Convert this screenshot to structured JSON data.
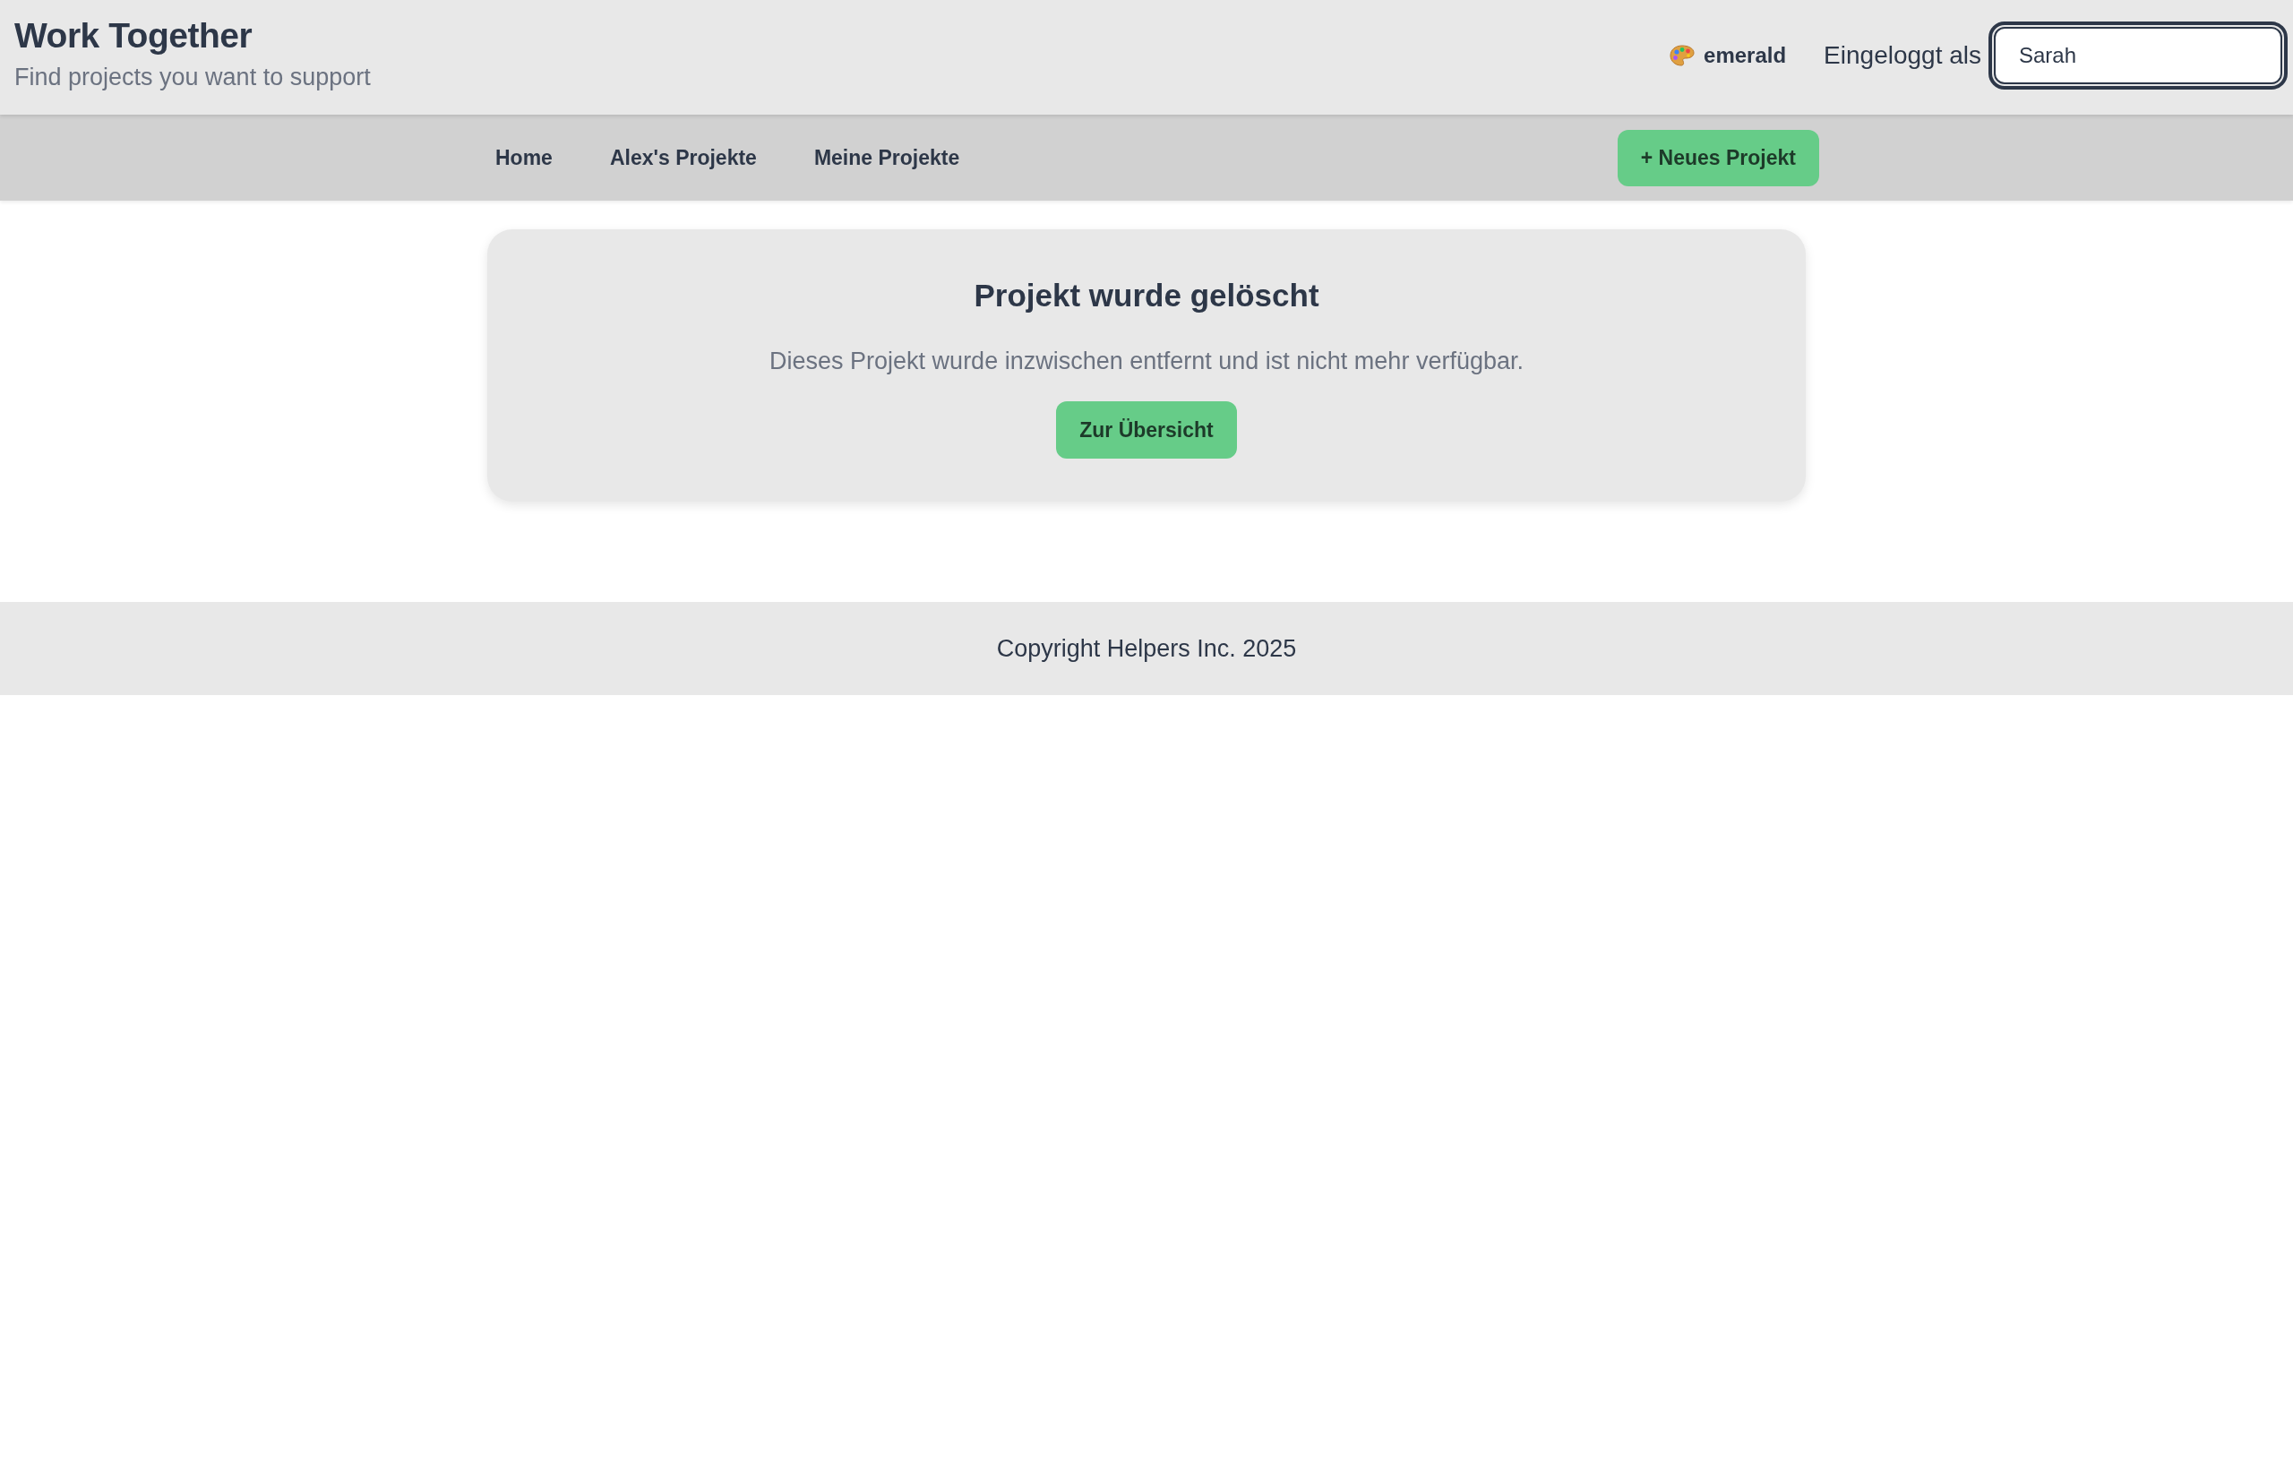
{
  "header": {
    "title": "Work Together",
    "subtitle": "Find projects you want to support",
    "theme": {
      "label": "emerald"
    },
    "login": {
      "label": "Eingeloggt als",
      "user_field": {
        "value": "Sarah",
        "focused": true
      }
    }
  },
  "nav": {
    "links": [
      "Home",
      "Alex's Projekte",
      "Meine Projekte"
    ],
    "new_button": "+ Neues Projekt"
  },
  "notice": {
    "title": "Projekt wurde gelöscht",
    "message": "Dieses Projekt wurde inzwischen entfernt und ist nicht mehr verfügbar.",
    "button": "Zur Übersicht"
  },
  "footer": {
    "text": "Copyright Helpers Inc. 2025"
  }
}
